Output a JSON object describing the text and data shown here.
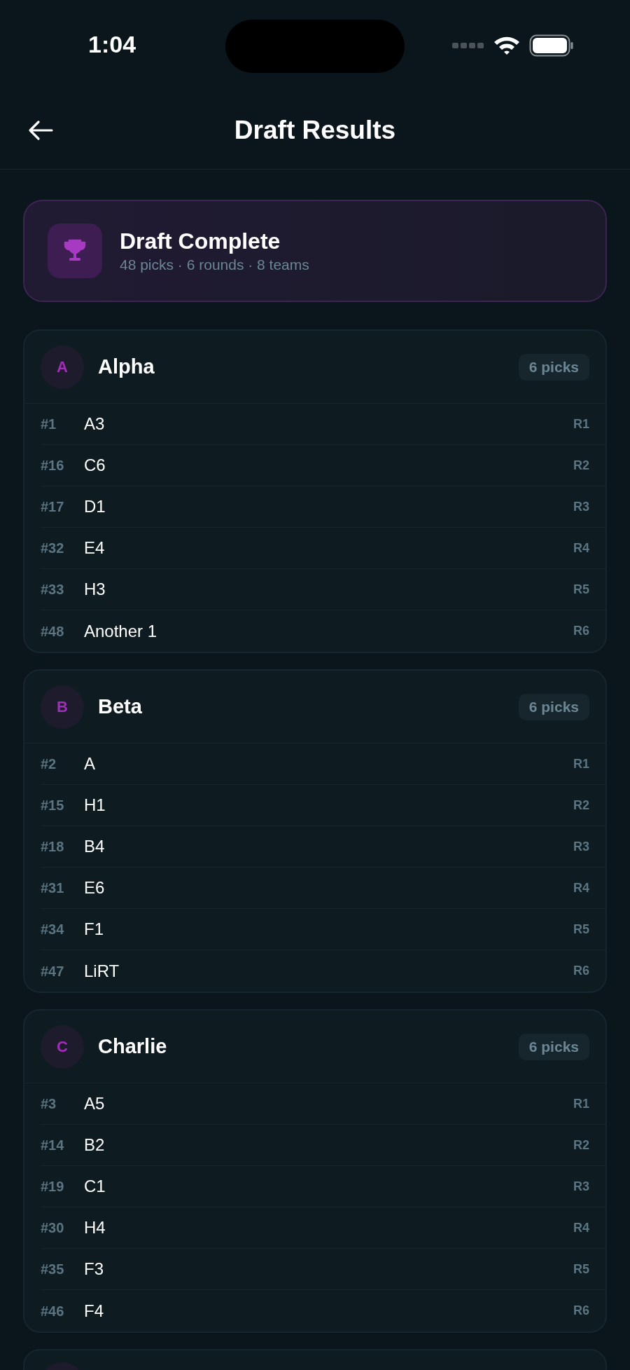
{
  "status_bar": {
    "time": "1:04"
  },
  "header": {
    "title": "Draft Results"
  },
  "summary": {
    "title": "Draft Complete",
    "subtitle": "48 picks · 6 rounds · 8 teams"
  },
  "teams": [
    {
      "initial": "A",
      "name": "Alpha",
      "badge": "6 picks",
      "picks": [
        {
          "number": "#1",
          "player": "A3",
          "round": "R1"
        },
        {
          "number": "#16",
          "player": "C6",
          "round": "R2"
        },
        {
          "number": "#17",
          "player": "D1",
          "round": "R3"
        },
        {
          "number": "#32",
          "player": "E4",
          "round": "R4"
        },
        {
          "number": "#33",
          "player": "H3",
          "round": "R5"
        },
        {
          "number": "#48",
          "player": "Another 1",
          "round": "R6"
        }
      ]
    },
    {
      "initial": "B",
      "name": "Beta",
      "badge": "6 picks",
      "picks": [
        {
          "number": "#2",
          "player": "A",
          "round": "R1"
        },
        {
          "number": "#15",
          "player": "H1",
          "round": "R2"
        },
        {
          "number": "#18",
          "player": "B4",
          "round": "R3"
        },
        {
          "number": "#31",
          "player": "E6",
          "round": "R4"
        },
        {
          "number": "#34",
          "player": "F1",
          "round": "R5"
        },
        {
          "number": "#47",
          "player": "LiRT",
          "round": "R6"
        }
      ]
    },
    {
      "initial": "C",
      "name": "Charlie",
      "badge": "6 picks",
      "picks": [
        {
          "number": "#3",
          "player": "A5",
          "round": "R1"
        },
        {
          "number": "#14",
          "player": "B2",
          "round": "R2"
        },
        {
          "number": "#19",
          "player": "C1",
          "round": "R3"
        },
        {
          "number": "#30",
          "player": "H4",
          "round": "R4"
        },
        {
          "number": "#35",
          "player": "F3",
          "round": "R5"
        },
        {
          "number": "#46",
          "player": "F4",
          "round": "R6"
        }
      ]
    }
  ]
}
